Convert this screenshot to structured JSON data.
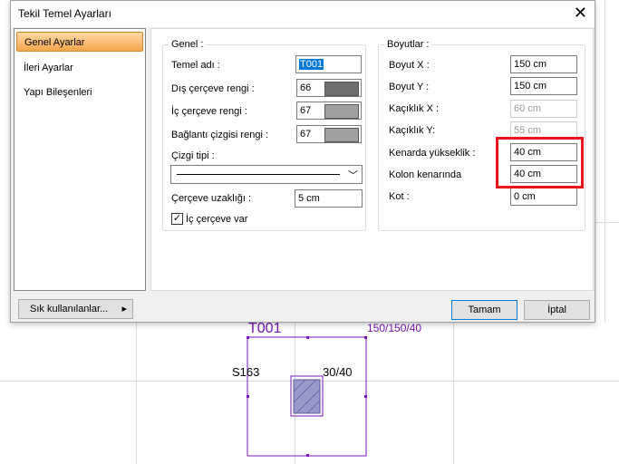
{
  "dialog": {
    "title": "Tekil Temel Ayarları",
    "close_glyph": "✕"
  },
  "nav": {
    "items": [
      {
        "label": "Genel Ayarlar",
        "active": true
      },
      {
        "label": "İleri Ayarlar",
        "active": false
      },
      {
        "label": "Yapı Bileşenleri",
        "active": false
      }
    ]
  },
  "genel": {
    "legend": "Genel :",
    "temel_adi": {
      "label": "Temel adı :",
      "value": "T001"
    },
    "dis_cerceve": {
      "label": "Dış çerçeve rengi :",
      "value": "66",
      "swatch": "#6e6e6e"
    },
    "ic_cerceve": {
      "label": "İç çerçeve rengi :",
      "value": "67",
      "swatch": "#a0a0a0"
    },
    "baglanti": {
      "label": "Bağlantı çizgisi rengi :",
      "value": "67",
      "swatch": "#a0a0a0"
    },
    "cizgi_tipi": {
      "label": "Çizgi tipi :"
    },
    "cerceve_uzakligi": {
      "label": "Çerçeve uzaklığı :",
      "value": "5 cm"
    },
    "ic_cerceve_var": {
      "label": "İç çerçeve var",
      "checked": "✓"
    }
  },
  "boyutlar": {
    "legend": "Boyutlar :",
    "boyut_x": {
      "label": "Boyut X :",
      "value": "150 cm"
    },
    "boyut_y": {
      "label": "Boyut Y :",
      "value": "150 cm"
    },
    "kaciklik_x": {
      "label": "Kaçıklık X :",
      "value": "60 cm"
    },
    "kaciklik_y": {
      "label": "Kaçıklık Y:",
      "value": "55 cm"
    },
    "kenarda": {
      "label": "Kenarda yükseklik :",
      "value": "40 cm"
    },
    "kolon": {
      "label": "Kolon kenarında",
      "value": "40 cm"
    },
    "kot": {
      "label": "Kot :",
      "value": "0 cm"
    }
  },
  "buttons": {
    "sik": "Sık kullanılanlar...",
    "sik_arrow": "▸",
    "tamam": "Tamam",
    "iptal": "İptal"
  },
  "drawing": {
    "footing_name": "T001",
    "footing_dims": "150/150/40",
    "column_name": "S163",
    "column_dims": "30/40",
    "line_color": "#7a16b8"
  }
}
